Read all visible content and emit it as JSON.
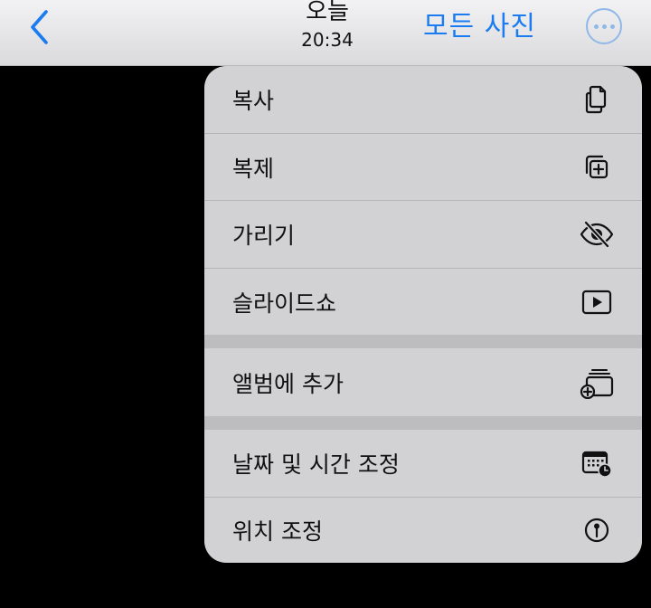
{
  "nav": {
    "title": "오늘",
    "subtitle": "20:34",
    "all_photos_label": "모든 사진",
    "back_icon": "chevron-left-icon",
    "more_icon": "ellipsis-circle-icon",
    "accent_color": "#1a7cf0"
  },
  "menu": {
    "items": [
      {
        "label": "복사",
        "icon": "copy-icon"
      },
      {
        "label": "복제",
        "icon": "duplicate-icon"
      },
      {
        "label": "가리기",
        "icon": "eye-slash-icon"
      },
      {
        "label": "슬라이드쇼",
        "icon": "play-rectangle-icon"
      },
      {
        "label": "앨범에 추가",
        "icon": "add-to-album-icon"
      },
      {
        "label": "날짜 및 시간 조정",
        "icon": "calendar-clock-icon"
      },
      {
        "label": "위치 조정",
        "icon": "location-pin-icon"
      }
    ]
  }
}
